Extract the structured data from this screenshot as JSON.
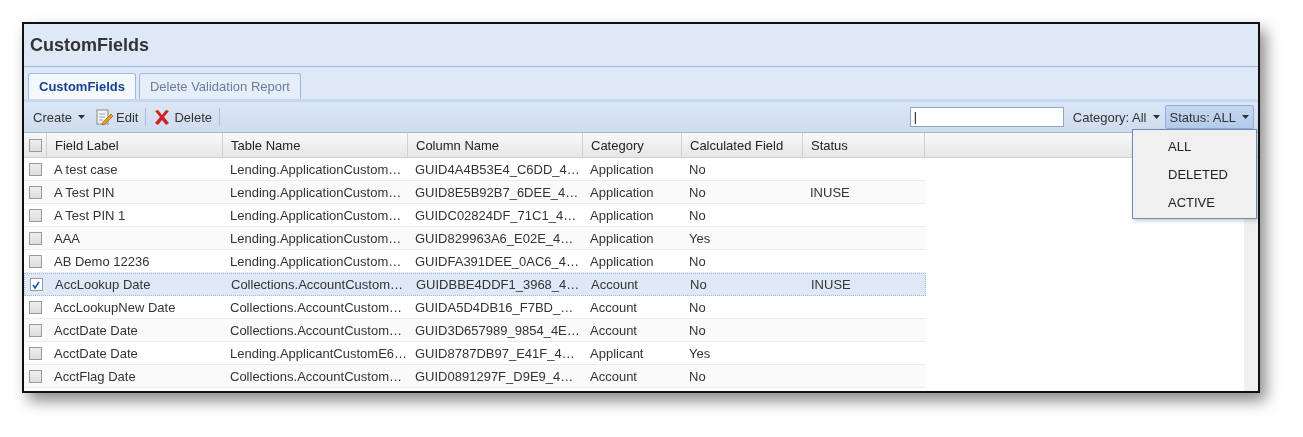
{
  "window": {
    "title": "CustomFields"
  },
  "tabs": [
    {
      "label": "CustomFields",
      "selected": true
    },
    {
      "label": "Delete Validation Report",
      "selected": false
    }
  ],
  "toolbar": {
    "create": "Create",
    "edit": "Edit",
    "delete": "Delete",
    "search": {
      "value": "|"
    },
    "category_filter": "Category: All",
    "status_filter": "Status: ALL"
  },
  "status_menu": {
    "items": [
      "ALL",
      "DELETED",
      "ACTIVE"
    ]
  },
  "table": {
    "header_checked": false,
    "columns": [
      "Field Label",
      "Table Name",
      "Column Name",
      "Category",
      "Calculated Field",
      "Status"
    ],
    "rows": [
      {
        "selected": false,
        "cells": [
          "A test case",
          "Lending.ApplicationCustom…",
          "GUID4A4B53E4_C6DD_4…",
          "Application",
          "No",
          ""
        ]
      },
      {
        "selected": false,
        "cells": [
          "A Test PIN",
          "Lending.ApplicationCustom…",
          "GUID8E5B92B7_6DEE_4…",
          "Application",
          "No",
          "INUSE"
        ]
      },
      {
        "selected": false,
        "cells": [
          "A Test PIN 1",
          "Lending.ApplicationCustom…",
          "GUIDC02824DF_71C1_4…",
          "Application",
          "No",
          ""
        ]
      },
      {
        "selected": false,
        "cells": [
          "AAA",
          "Lending.ApplicationCustom…",
          "GUID829963A6_E02E_4…",
          "Application",
          "Yes",
          ""
        ]
      },
      {
        "selected": false,
        "cells": [
          "AB Demo 12236",
          "Lending.ApplicationCustom…",
          "GUIDFA391DEE_0AC6_4…",
          "Application",
          "No",
          ""
        ]
      },
      {
        "selected": true,
        "cells": [
          "AccLookup Date",
          "Collections.AccountCustom…",
          "GUIDBBE4DDF1_3968_4…",
          "Account",
          "No",
          "INUSE"
        ]
      },
      {
        "selected": false,
        "cells": [
          "AccLookupNew Date",
          "Collections.AccountCustom…",
          "GUIDA5D4DB16_F7BD_…",
          "Account",
          "No",
          ""
        ]
      },
      {
        "selected": false,
        "cells": [
          "AcctDate Date",
          "Collections.AccountCustom…",
          "GUID3D657989_9854_4E…",
          "Account",
          "No",
          ""
        ]
      },
      {
        "selected": false,
        "cells": [
          "AcctDate Date",
          "Lending.ApplicantCustomE6…",
          "GUID8787DB97_E41F_4…",
          "Applicant",
          "Yes",
          ""
        ]
      },
      {
        "selected": false,
        "cells": [
          "AcctFlag Date",
          "Collections.AccountCustom…",
          "GUID0891297F_D9E9_4…",
          "Account",
          "No",
          ""
        ]
      }
    ]
  }
}
